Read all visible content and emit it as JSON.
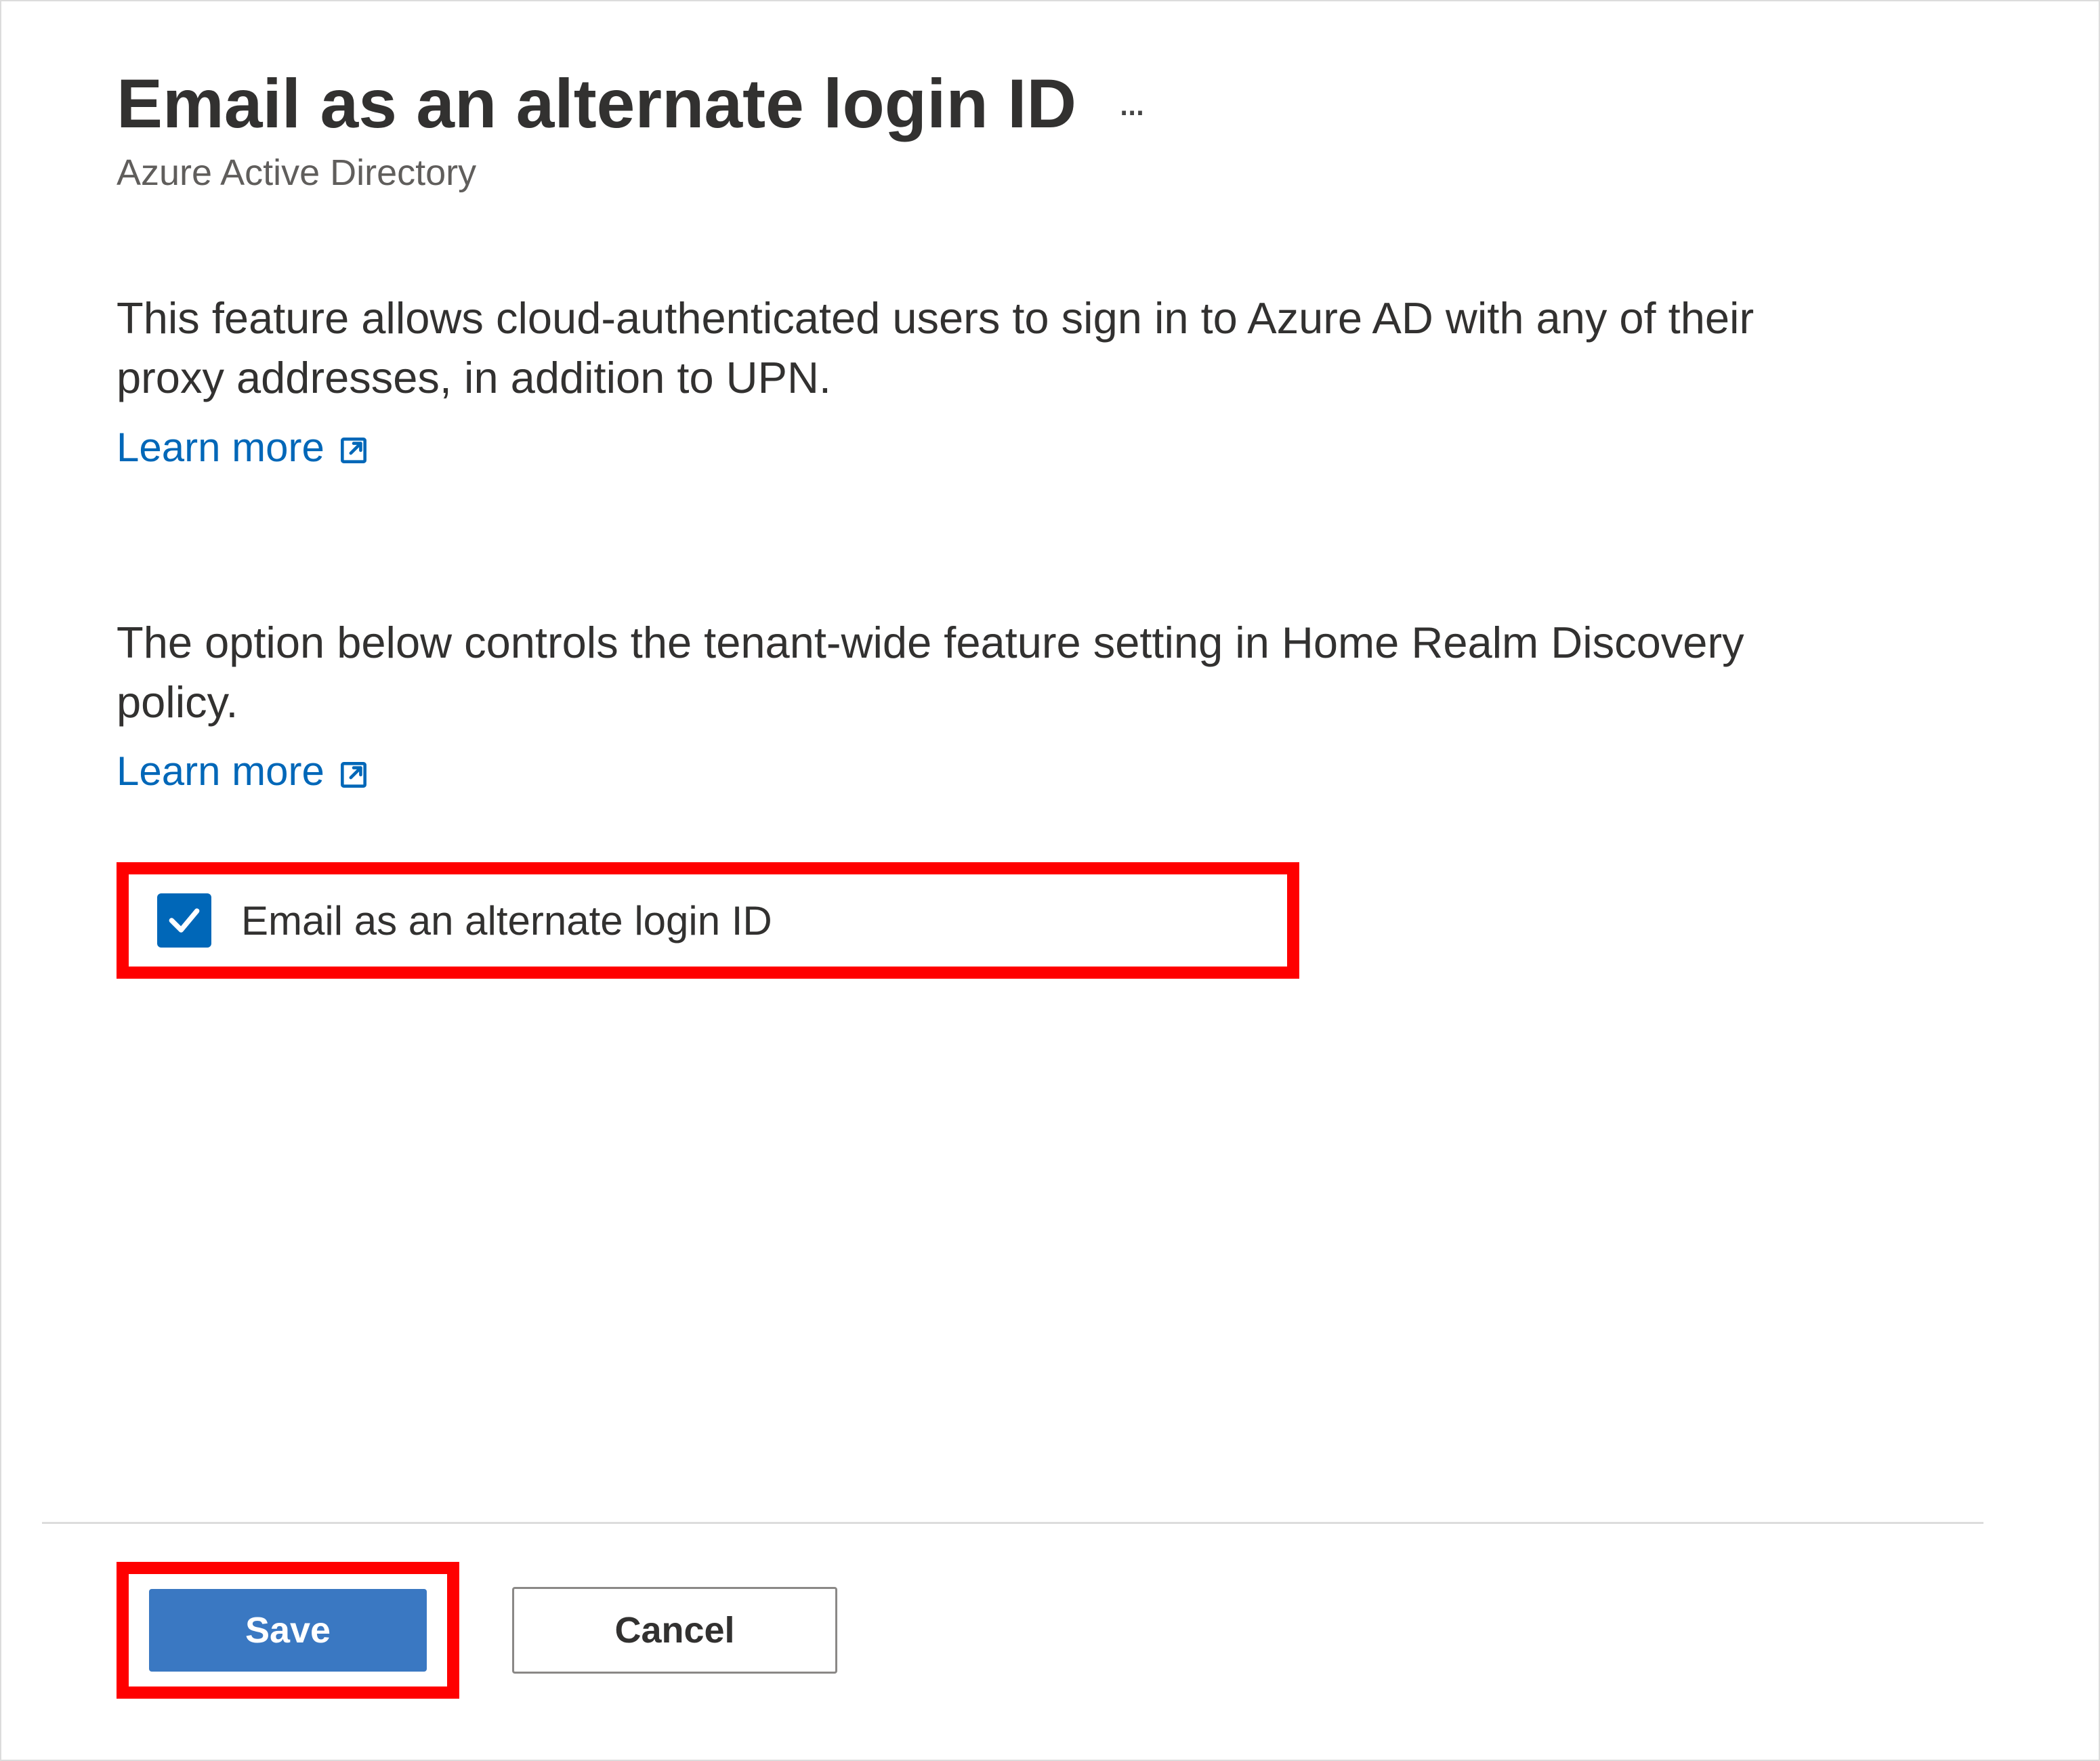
{
  "header": {
    "title": "Email as an alternate login ID",
    "subtitle": "Azure Active Directory"
  },
  "sections": {
    "feature_description": "This feature allows cloud-authenticated users to sign in to Azure AD with any of their proxy addresses, in addition to UPN.",
    "learn_more_1": "Learn more",
    "option_description": "The option below controls the tenant-wide feature setting in Home Realm Discovery policy.",
    "learn_more_2": "Learn more"
  },
  "checkbox": {
    "label": "Email as an alternate login ID",
    "checked": true
  },
  "actions": {
    "save_label": "Save",
    "cancel_label": "Cancel"
  },
  "colors": {
    "link": "#0067b8",
    "primary_button": "#3a78c2",
    "highlight_border": "#ff0000"
  }
}
